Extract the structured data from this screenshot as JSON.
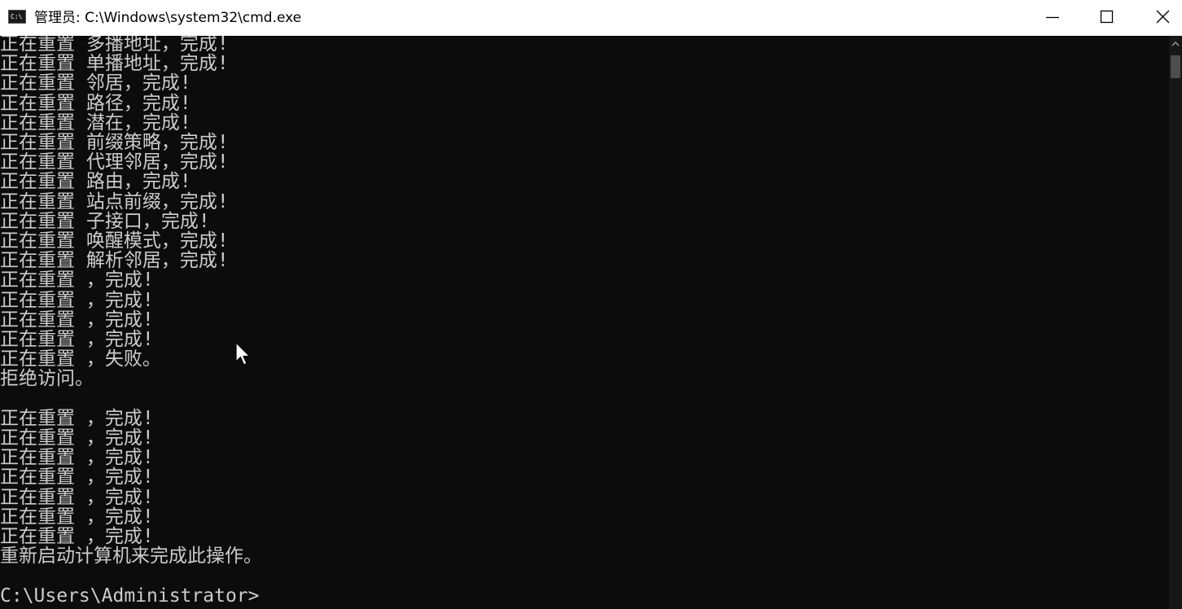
{
  "window": {
    "title": "管理员: C:\\Windows\\system32\\cmd.exe",
    "icon_label": "C:\\",
    "controls": {
      "minimize": "minimize-icon",
      "maximize": "maximize-icon",
      "close": "close-icon"
    }
  },
  "console": {
    "lines": [
      "正在重置 多播地址，完成!",
      "正在重置 单播地址，完成!",
      "正在重置 邻居，完成!",
      "正在重置 路径，完成!",
      "正在重置 潜在，完成!",
      "正在重置 前缀策略，完成!",
      "正在重置 代理邻居，完成!",
      "正在重置 路由，完成!",
      "正在重置 站点前缀，完成!",
      "正在重置 子接口，完成!",
      "正在重置 唤醒模式，完成!",
      "正在重置 解析邻居，完成!",
      "正在重置 ，完成!",
      "正在重置 ，完成!",
      "正在重置 ，完成!",
      "正在重置 ，完成!",
      "正在重置 ，失败。",
      "拒绝访问。",
      "",
      "正在重置 ，完成!",
      "正在重置 ，完成!",
      "正在重置 ，完成!",
      "正在重置 ，完成!",
      "正在重置 ，完成!",
      "正在重置 ，完成!",
      "正在重置 ，完成!",
      "重新启动计算机来完成此操作。",
      "",
      "C:\\Users\\Administrator>"
    ]
  },
  "colors": {
    "console_bg": "#0c0c0c",
    "console_text": "#cccccc",
    "titlebar_bg": "#ffffff",
    "scrollbar_bg": "#171717",
    "scroll_thumb": "#4d4d4d"
  }
}
